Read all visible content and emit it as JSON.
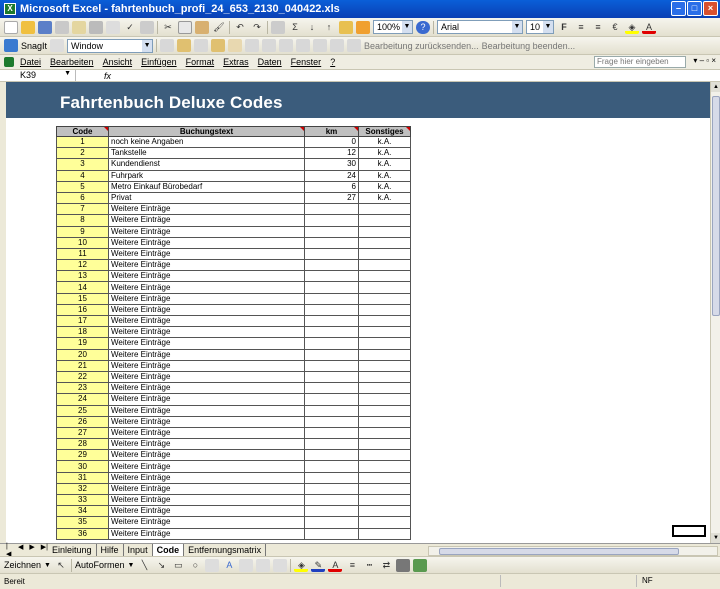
{
  "window": {
    "title": "Microsoft Excel - fahrtenbuch_profi_24_653_2130_040422.xls"
  },
  "toolbar": {
    "zoom": "100%",
    "font": "Arial",
    "font_size": "10",
    "snagit_label": "SnagIt",
    "snagit_mode": "Window",
    "review_reply": "Bearbeitung zurücksenden...",
    "review_end": "Bearbeitung beenden..."
  },
  "menu": {
    "items": [
      "Datei",
      "Bearbeiten",
      "Ansicht",
      "Einfügen",
      "Format",
      "Extras",
      "Daten",
      "Fenster",
      "?"
    ],
    "help_placeholder": "Frage hier eingeben"
  },
  "formula": {
    "cell_ref": "K39",
    "fx": "fx",
    "content": ""
  },
  "sheet": {
    "title": "Fahrtenbuch Deluxe Codes",
    "columns": [
      "Code",
      "Buchungstext",
      "km",
      "Sonstiges"
    ],
    "rows": [
      {
        "code": "1",
        "text": "noch keine Angaben",
        "km": "0",
        "other": "k.A."
      },
      {
        "code": "2",
        "text": "Tankstelle",
        "km": "12",
        "other": "k.A."
      },
      {
        "code": "3",
        "text": "Kundendienst",
        "km": "30",
        "other": "k.A."
      },
      {
        "code": "4",
        "text": "Fuhrpark",
        "km": "24",
        "other": "k.A."
      },
      {
        "code": "5",
        "text": "Metro Einkauf Bürobedarf",
        "km": "6",
        "other": "k.A."
      },
      {
        "code": "6",
        "text": "Privat",
        "km": "27",
        "other": "k.A."
      },
      {
        "code": "7",
        "text": "Weitere Einträge",
        "km": "",
        "other": ""
      },
      {
        "code": "8",
        "text": "Weitere Einträge",
        "km": "",
        "other": ""
      },
      {
        "code": "9",
        "text": "Weitere Einträge",
        "km": "",
        "other": ""
      },
      {
        "code": "10",
        "text": "Weitere Einträge",
        "km": "",
        "other": ""
      },
      {
        "code": "11",
        "text": "Weitere Einträge",
        "km": "",
        "other": ""
      },
      {
        "code": "12",
        "text": "Weitere Einträge",
        "km": "",
        "other": ""
      },
      {
        "code": "13",
        "text": "Weitere Einträge",
        "km": "",
        "other": ""
      },
      {
        "code": "14",
        "text": "Weitere Einträge",
        "km": "",
        "other": ""
      },
      {
        "code": "15",
        "text": "Weitere Einträge",
        "km": "",
        "other": ""
      },
      {
        "code": "16",
        "text": "Weitere Einträge",
        "km": "",
        "other": ""
      },
      {
        "code": "17",
        "text": "Weitere Einträge",
        "km": "",
        "other": ""
      },
      {
        "code": "18",
        "text": "Weitere Einträge",
        "km": "",
        "other": ""
      },
      {
        "code": "19",
        "text": "Weitere Einträge",
        "km": "",
        "other": ""
      },
      {
        "code": "20",
        "text": "Weitere Einträge",
        "km": "",
        "other": ""
      },
      {
        "code": "21",
        "text": "Weitere Einträge",
        "km": "",
        "other": ""
      },
      {
        "code": "22",
        "text": "Weitere Einträge",
        "km": "",
        "other": ""
      },
      {
        "code": "23",
        "text": "Weitere Einträge",
        "km": "",
        "other": ""
      },
      {
        "code": "24",
        "text": "Weitere Einträge",
        "km": "",
        "other": ""
      },
      {
        "code": "25",
        "text": "Weitere Einträge",
        "km": "",
        "other": ""
      },
      {
        "code": "26",
        "text": "Weitere Einträge",
        "km": "",
        "other": ""
      },
      {
        "code": "27",
        "text": "Weitere Einträge",
        "km": "",
        "other": ""
      },
      {
        "code": "28",
        "text": "Weitere Einträge",
        "km": "",
        "other": ""
      },
      {
        "code": "29",
        "text": "Weitere Einträge",
        "km": "",
        "other": ""
      },
      {
        "code": "30",
        "text": "Weitere Einträge",
        "km": "",
        "other": ""
      },
      {
        "code": "31",
        "text": "Weitere Einträge",
        "km": "",
        "other": ""
      },
      {
        "code": "32",
        "text": "Weitere Einträge",
        "km": "",
        "other": ""
      },
      {
        "code": "33",
        "text": "Weitere Einträge",
        "km": "",
        "other": ""
      },
      {
        "code": "34",
        "text": "Weitere Einträge",
        "km": "",
        "other": ""
      },
      {
        "code": "35",
        "text": "Weitere Einträge",
        "km": "",
        "other": ""
      },
      {
        "code": "36",
        "text": "Weitere Einträge",
        "km": "",
        "other": ""
      }
    ]
  },
  "tabs": [
    "Einleitung",
    "Hilfe",
    "Input",
    "Code",
    "Entfernungsmatrix"
  ],
  "active_tab": "Code",
  "drawing": {
    "draw_label": "Zeichnen",
    "autoshapes_label": "AutoFormen"
  },
  "status": {
    "ready": "Bereit",
    "nf": "NF"
  },
  "colors": {
    "banner": "#3b5c7c",
    "code_fill": "#ffff99",
    "header_fill": "#c0c0c0",
    "titlebar": "#0a4fc8"
  }
}
